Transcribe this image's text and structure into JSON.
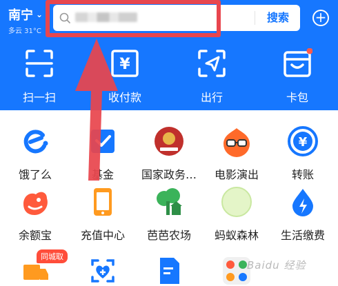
{
  "header": {
    "city": "南宁",
    "weather": "多云 31°C",
    "search_button_label": "搜索",
    "plus_symbol": "+"
  },
  "top_actions": [
    {
      "label": "扫一扫",
      "icon": "scan-icon"
    },
    {
      "label": "收付款",
      "icon": "payment-icon"
    },
    {
      "label": "出行",
      "icon": "travel-icon"
    },
    {
      "label": "卡包",
      "icon": "card-bag-icon"
    }
  ],
  "apps_row1": [
    {
      "label": "饿了么",
      "icon": "eleme-icon"
    },
    {
      "label": "基金",
      "icon": "fund-icon"
    },
    {
      "label": "国家政务…",
      "icon": "gov-services-icon"
    },
    {
      "label": "电影演出",
      "icon": "movie-icon"
    },
    {
      "label": "转账",
      "icon": "transfer-icon"
    }
  ],
  "apps_row2": [
    {
      "label": "余额宝",
      "icon": "yuebao-icon"
    },
    {
      "label": "充值中心",
      "icon": "recharge-icon"
    },
    {
      "label": "芭芭农场",
      "icon": "farm-icon"
    },
    {
      "label": "蚂蚁森林",
      "icon": "forest-icon"
    },
    {
      "label": "生活缴费",
      "icon": "utilities-icon"
    }
  ],
  "apps_row3": [
    {
      "icon": "delivery-icon",
      "badge": "同城取"
    },
    {
      "icon": "health-icon"
    },
    {
      "icon": "document-icon"
    },
    {
      "icon": "more-apps-icon"
    }
  ],
  "watermark": "Baidu 经验",
  "colors": {
    "brand_blue": "#1677ff",
    "highlight_red": "#e8464e"
  }
}
